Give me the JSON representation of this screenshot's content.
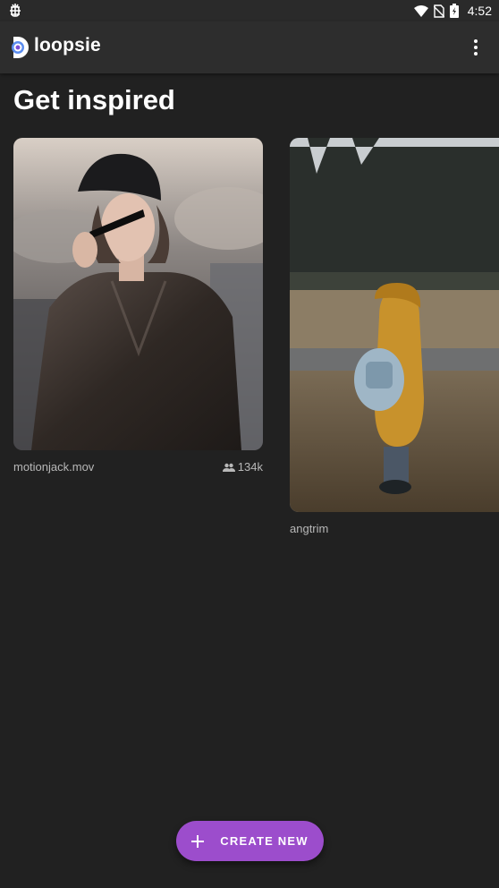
{
  "status_bar": {
    "time": "4:52",
    "icons": [
      "debug-bug-icon",
      "wifi-icon",
      "no-sim-icon",
      "battery-charging-icon"
    ]
  },
  "app_bar": {
    "app_name": "loopsie",
    "logo_icon": "loopsie-logo-icon",
    "menu_icon": "more-vert-icon"
  },
  "main": {
    "heading": "Get inspired",
    "cards": [
      {
        "caption": "motionjack.mov",
        "count": "134k",
        "count_icon": "people-icon",
        "image_desc": "woman-in-leather-jacket"
      },
      {
        "caption": "angtrim",
        "image_desc": "child-in-yellow-raincoat"
      }
    ]
  },
  "fab": {
    "label": "CREATE NEW",
    "icon": "plus-icon",
    "color": "#9c4dcc"
  }
}
